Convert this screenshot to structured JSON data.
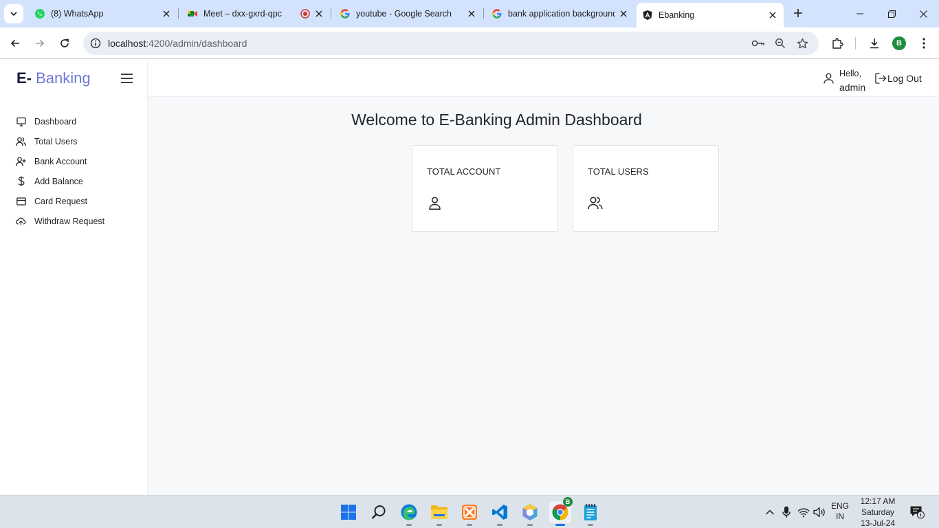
{
  "browser": {
    "tabs": [
      {
        "title": "(8) WhatsApp",
        "icon": "whatsapp-icon",
        "active": false
      },
      {
        "title": "Meet – dxx-gxrd-qpc",
        "icon": "google-meet-icon",
        "active": false,
        "recording": true
      },
      {
        "title": "youtube - Google Search",
        "icon": "google-icon",
        "active": false
      },
      {
        "title": "bank application background",
        "icon": "google-icon",
        "active": false
      },
      {
        "title": "Ebanking",
        "icon": "angular-icon",
        "active": true
      }
    ],
    "url_host": "localhost",
    "url_path": ":4200/admin/dashboard",
    "profile_initial": "B"
  },
  "app": {
    "brand_prefix": "E-",
    "brand_suffix": "Banking",
    "menu": [
      {
        "label": "Dashboard",
        "icon": "monitor-icon"
      },
      {
        "label": "Total Users",
        "icon": "users-icon"
      },
      {
        "label": "Bank Account",
        "icon": "user-plus-icon"
      },
      {
        "label": "Add Balance",
        "icon": "dollar-icon"
      },
      {
        "label": "Card Request",
        "icon": "credit-card-icon"
      },
      {
        "label": "Withdraw Request",
        "icon": "cloud-upload-icon"
      }
    ],
    "header": {
      "greeting": "Hello,",
      "username": "admin",
      "logout_label": "Log Out"
    },
    "welcome": "Welcome to E-Banking Admin Dashboard",
    "cards": [
      {
        "title": "TOTAL ACCOUNT",
        "icon": "user-icon"
      },
      {
        "title": "TOTAL USERS",
        "icon": "users-icon"
      }
    ]
  },
  "taskbar": {
    "lang_top": "ENG",
    "lang_bottom": "IN",
    "time": "12:17 AM",
    "day": "Saturday",
    "date": "13-Jul-24",
    "chrome_badge": "B"
  }
}
